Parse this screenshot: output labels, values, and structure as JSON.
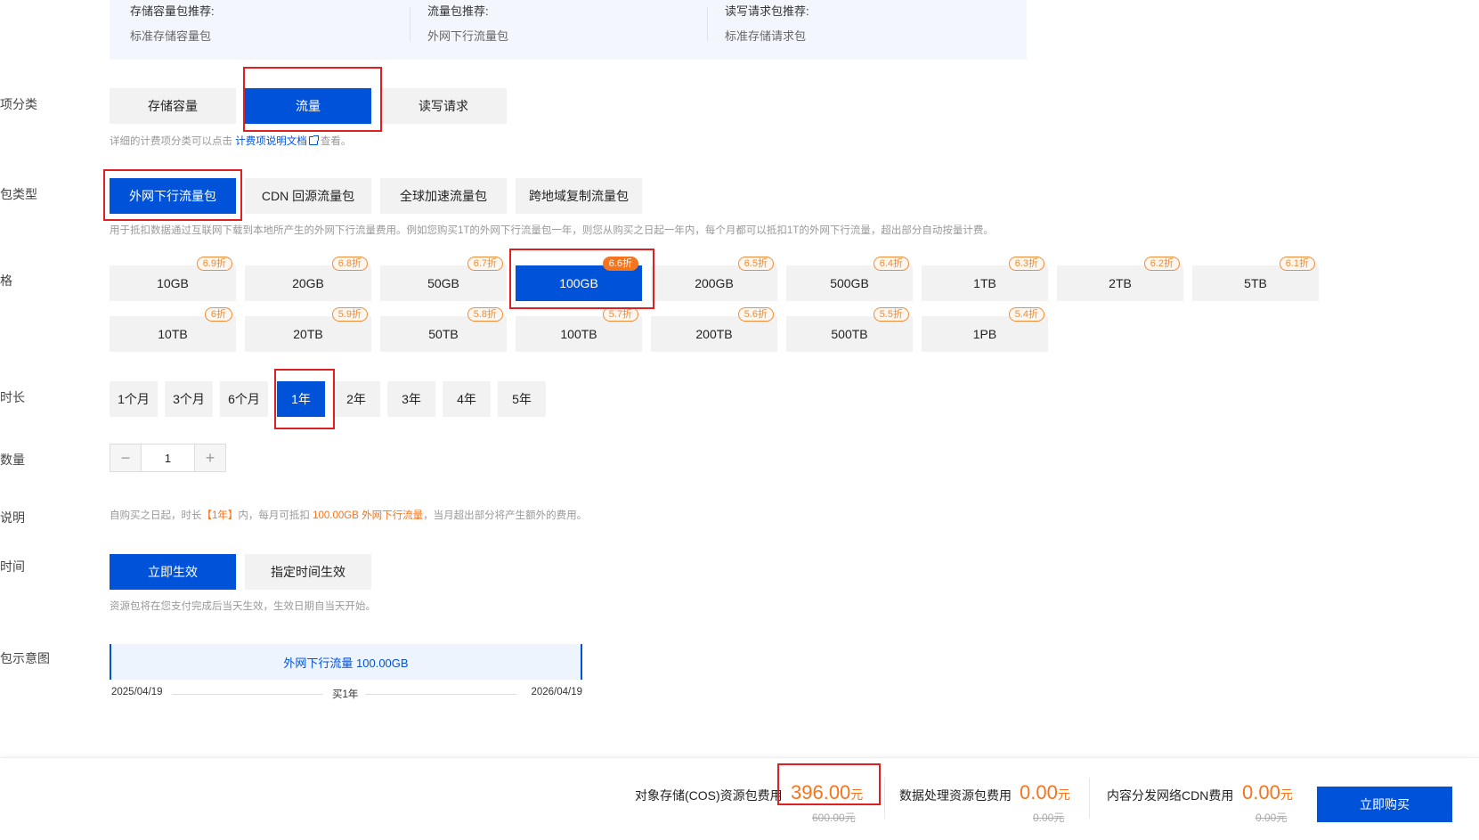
{
  "recommend": [
    {
      "title": "存储容量包推荐:",
      "value": "标准存储容量包"
    },
    {
      "title": "流量包推荐:",
      "value": "外网下行流量包"
    },
    {
      "title": "读写请求包推荐:",
      "value": "标准存储请求包"
    }
  ],
  "labels": {
    "category": "项分类",
    "pkg_type": "包类型",
    "spec": "格",
    "duration": "时长",
    "quantity": "数量",
    "explain": "说明",
    "effective": "时间",
    "diagram": "包示意图"
  },
  "category": {
    "options": [
      "存储容量",
      "流量",
      "读写请求"
    ],
    "selected": "流量",
    "hint_prefix": "详细的计费项分类可以点击",
    "hint_link": "计费项说明文档",
    "hint_suffix": "查看。"
  },
  "pkg_type": {
    "options": [
      "外网下行流量包",
      "CDN 回源流量包",
      "全球加速流量包",
      "跨地域复制流量包"
    ],
    "selected": "外网下行流量包",
    "hint": "用于抵扣数据通过互联网下载到本地所产生的外网下行流量费用。例如您购买1T的外网下行流量包一年，则您从购买之日起一年内，每个月都可以抵扣1T的外网下行流量，超出部分自动按量计费。"
  },
  "spec": {
    "row1": [
      {
        "label": "10GB",
        "discount": "6.9折"
      },
      {
        "label": "20GB",
        "discount": "6.8折"
      },
      {
        "label": "50GB",
        "discount": "6.7折"
      },
      {
        "label": "100GB",
        "discount": "6.6折"
      },
      {
        "label": "200GB",
        "discount": "6.5折"
      },
      {
        "label": "500GB",
        "discount": "6.4折"
      },
      {
        "label": "1TB",
        "discount": "6.3折"
      },
      {
        "label": "2TB",
        "discount": "6.2折"
      },
      {
        "label": "5TB",
        "discount": "6.1折"
      }
    ],
    "row2": [
      {
        "label": "10TB",
        "discount": "6折"
      },
      {
        "label": "20TB",
        "discount": "5.9折"
      },
      {
        "label": "50TB",
        "discount": "5.8折"
      },
      {
        "label": "100TB",
        "discount": "5.7折"
      },
      {
        "label": "200TB",
        "discount": "5.6折"
      },
      {
        "label": "500TB",
        "discount": "5.5折"
      },
      {
        "label": "1PB",
        "discount": "5.4折"
      }
    ],
    "selected": "100GB"
  },
  "duration": {
    "options": [
      "1个月",
      "3个月",
      "6个月",
      "1年",
      "2年",
      "3年",
      "4年",
      "5年"
    ],
    "selected": "1年"
  },
  "quantity": {
    "minus": "−",
    "value": "1",
    "plus": "+"
  },
  "explain": {
    "p1": "自购买之日起，时长",
    "dur": "【1年】",
    "p2": "内，每月可抵扣",
    "amount": "100.00GB 外网下行流量",
    "p3": "，当月超出部分将产生额外的费用。"
  },
  "effective": {
    "options": [
      "立即生效",
      "指定时间生效"
    ],
    "selected": "立即生效",
    "hint": "资源包将在您支付完成后当天生效，生效日期自当天开始。"
  },
  "diagram": {
    "bar": "外网下行流量 100.00GB",
    "start": "2025/04/19",
    "mid": "买1年",
    "end": "2026/04/19"
  },
  "footer": {
    "cos_label": "对象存储(COS)资源包费用",
    "cos_price": "396.00",
    "cos_orig": "600.00元",
    "dp_label": "数据处理资源包费用",
    "dp_price": "0.00",
    "dp_orig": "0.00元",
    "cdn_label": "内容分发网络CDN费用",
    "cdn_price": "0.00",
    "cdn_orig": "0.00元",
    "unit": "元",
    "buy": "立即购买"
  },
  "colors": {
    "accent": "#0052d9",
    "price": "#f5741c",
    "highlight_box": "#e02020"
  }
}
